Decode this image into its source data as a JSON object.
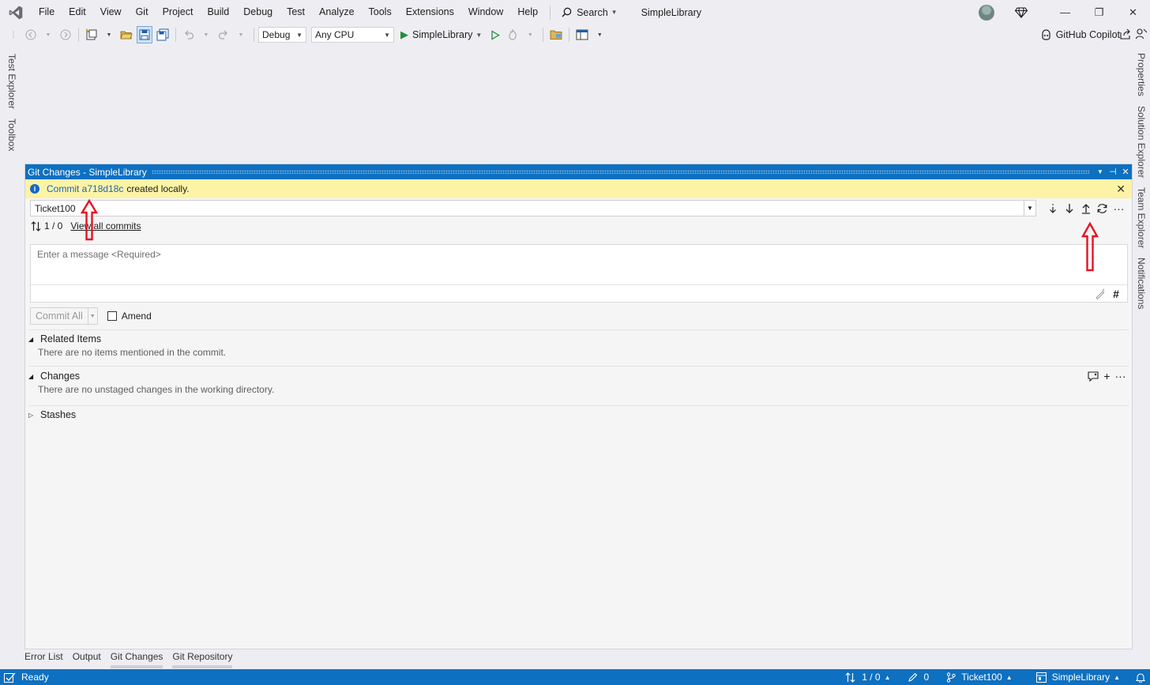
{
  "menu": {
    "items": [
      "File",
      "Edit",
      "View",
      "Git",
      "Project",
      "Build",
      "Debug",
      "Test",
      "Analyze",
      "Tools",
      "Extensions",
      "Window",
      "Help"
    ],
    "search_label": "Search",
    "window_title": "SimpleLibrary"
  },
  "toolbar": {
    "configuration": "Debug",
    "platform": "Any CPU",
    "startup_project": "SimpleLibrary",
    "copilot_label": "GitHub Copilot"
  },
  "left_tabs": [
    "Test Explorer",
    "Toolbox"
  ],
  "right_tabs": [
    "Properties",
    "Solution Explorer",
    "Team Explorer",
    "Notifications"
  ],
  "git_panel": {
    "title": "Git Changes - SimpleLibrary",
    "info": {
      "link_text": "Commit a718d18c",
      "rest_text": "created locally."
    },
    "branch": "Ticket100",
    "outgoing_incoming": "1 / 0",
    "view_all_commits": "View all commits",
    "message_placeholder": "Enter a message <Required>",
    "commit_button": "Commit All",
    "amend_label": "Amend",
    "amend_checked": false,
    "sections": {
      "related_items": {
        "title": "Related Items",
        "subtitle": "There are no items mentioned in the commit."
      },
      "changes": {
        "title": "Changes",
        "subtitle": "There are no unstaged changes in the working directory."
      },
      "stashes": {
        "title": "Stashes"
      }
    }
  },
  "bottom_tabs": [
    "Error List",
    "Output",
    "Git Changes",
    "Git Repository"
  ],
  "statusbar": {
    "ready": "Ready",
    "sync": "1 / 0",
    "pending": "0",
    "branch": "Ticket100",
    "repo": "SimpleLibrary"
  },
  "colors": {
    "accent": "#0e70c0",
    "infobar": "#fcf3a6",
    "annotation": "#e81123"
  }
}
